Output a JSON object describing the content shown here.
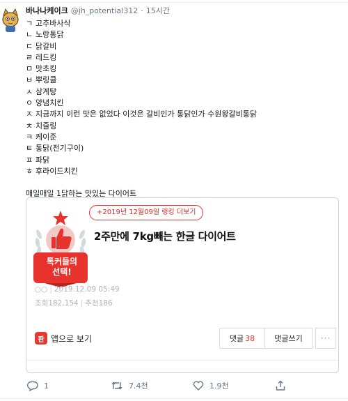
{
  "tweet": {
    "author_name": "바나나케이크",
    "handle": "@jh_potential312",
    "dot": "·",
    "time": "15시간",
    "list": [
      {
        "jamo": "ㄱ",
        "text": "고추바사삭"
      },
      {
        "jamo": "ㄴ",
        "text": "노랑통닭"
      },
      {
        "jamo": "ㄷ",
        "text": "닭갈비"
      },
      {
        "jamo": "ㄹ",
        "text": "레드킹"
      },
      {
        "jamo": "ㅁ",
        "text": "맛초킹"
      },
      {
        "jamo": "ㅂ",
        "text": "뿌링클"
      },
      {
        "jamo": "ㅅ",
        "text": "삼계탕"
      },
      {
        "jamo": "ㅇ",
        "text": "양념치킨"
      },
      {
        "jamo": "ㅈ",
        "text": "지금까지 이런 맛은 없었다 이것은 갈비인가 통닭인가 수원왕갈비통닭"
      },
      {
        "jamo": "ㅊ",
        "text": "치즐링"
      },
      {
        "jamo": "ㅋ",
        "text": "케이준"
      },
      {
        "jamo": "ㅌ",
        "text": "통닭(전기구이)"
      },
      {
        "jamo": "ㅍ",
        "text": "파닭"
      },
      {
        "jamo": "ㅎ",
        "text": "후라이드치킨"
      }
    ],
    "closing": "매일매일 1닭하는 맛있는 다이어트"
  },
  "card": {
    "rank_label": "+2019년 12월09일 랭킹 더보기",
    "badge_line1": "톡커들의",
    "badge_line2": "선택!",
    "headline": "2주만에 7kg빼는 한글 다이어트",
    "author_mask": "○○",
    "date": "2019.12.09 05:49",
    "views": "조회182,154",
    "recommends": "추천186",
    "app_logo_glyph": "판",
    "app_label": "앱으로 보기",
    "comments_label": "댓글",
    "comments_count": "38",
    "write_label": "댓글쓰기",
    "more_label": "···"
  },
  "actions": {
    "replies": "1",
    "retweets": "7.4천",
    "likes": "1.9천"
  },
  "colors": {
    "accent_red": "#e8322d",
    "muted_gray": "#657786",
    "border": "#ccd6dd"
  },
  "icons": [
    "avatar-cat",
    "star-icon",
    "thumbs-up-icon",
    "laurel-icon",
    "reply-icon",
    "retweet-icon",
    "like-icon",
    "share-icon"
  ]
}
